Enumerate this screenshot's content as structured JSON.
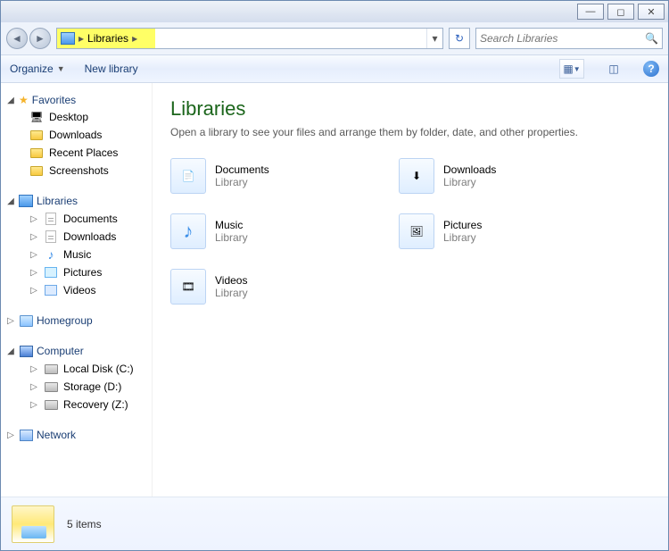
{
  "titlebar": {
    "min_tip": "Minimize",
    "max_tip": "Maximize",
    "close_tip": "Close"
  },
  "nav": {
    "back_tip": "Back",
    "forward_tip": "Forward",
    "breadcrumb_root": "Libraries",
    "refresh_tip": "Refresh"
  },
  "search": {
    "placeholder": "Search Libraries"
  },
  "toolbar": {
    "organize": "Organize",
    "newlibrary": "New library",
    "views_tip": "Change your view",
    "preview_tip": "Show the preview pane",
    "help_tip": "Get help"
  },
  "sidebar": {
    "favorites": {
      "label": "Favorites",
      "items": [
        "Desktop",
        "Downloads",
        "Recent Places",
        "Screenshots"
      ]
    },
    "libraries": {
      "label": "Libraries",
      "items": [
        "Documents",
        "Downloads",
        "Music",
        "Pictures",
        "Videos"
      ]
    },
    "homegroup": "Homegroup",
    "computer": {
      "label": "Computer",
      "items": [
        "Local Disk (C:)",
        "Storage (D:)",
        "Recovery (Z:)"
      ]
    },
    "network": "Network"
  },
  "content": {
    "title": "Libraries",
    "subtitle": "Open a library to see your files and arrange them by folder, date, and other properties.",
    "type_label": "Library",
    "items": [
      {
        "name": "Documents"
      },
      {
        "name": "Downloads"
      },
      {
        "name": "Music"
      },
      {
        "name": "Pictures"
      },
      {
        "name": "Videos"
      }
    ]
  },
  "statusbar": {
    "count": "5 items"
  }
}
